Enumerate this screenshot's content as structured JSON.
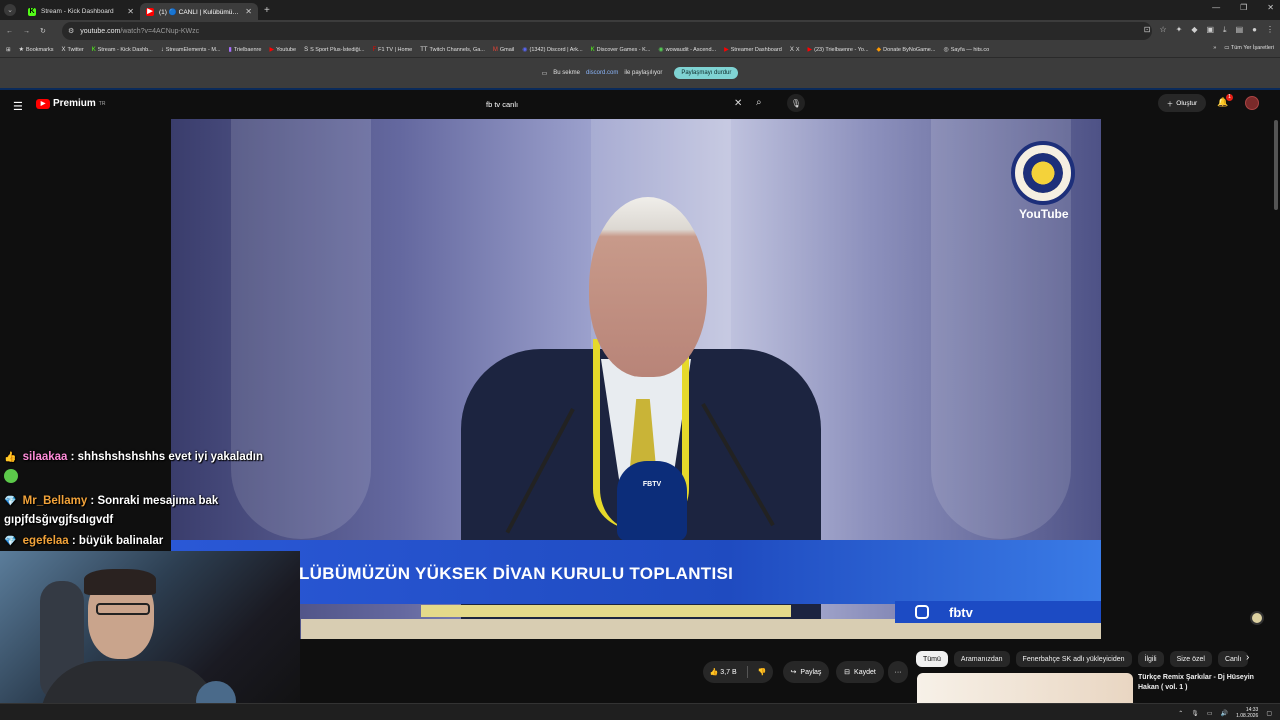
{
  "browser": {
    "tabs": [
      {
        "title": "Stream - Kick Dashboard",
        "icon": "kick-icon",
        "active": false
      },
      {
        "title": "(1) 🔵 CANLI | Kulübümüzün...",
        "icon": "youtube-icon",
        "active": true
      }
    ],
    "new_tab": "+",
    "url_host": "youtube.com",
    "url_path": "/watch?v=4ACNup-KWzc",
    "bookmarks": [
      "Bookmarks",
      "Twitter",
      "Stream - Kick Dashb...",
      "StreamElements - M...",
      "Trielbaenre",
      "Youtube",
      "S Sport Plus-İstediği...",
      "F1 TV | Home",
      "Twitch Channels, Ga...",
      "Gmail",
      "(1342) Discord | Ark...",
      "Discover Games - K...",
      "wowaudit - Ascend...",
      "Streamer Dashboard",
      "X",
      "(23) Trielbaenre - Yo...",
      "Donate ByNoGame...",
      "Sayfa — hits.co"
    ],
    "bookmarks_more": "»",
    "all_bookmarks": "Tüm Yer İşaretleri"
  },
  "share_bar": {
    "prefix": "Bu sekme",
    "domain": "discord.com",
    "suffix": "ile paylaşılıyor",
    "stop_button": "Paylaşmayı durdur"
  },
  "youtube": {
    "logo_text": "Premium",
    "logo_region": "TR",
    "search_value": "fb tv canlı",
    "create_button": "Oluştur",
    "notif_count": "1"
  },
  "video": {
    "lower_third": "LÜBÜMÜZÜN YÜKSEK DİVAN KURULU TOPLANTISI",
    "watermark": "YouTube",
    "handle": "fbtv",
    "mic_label": "FBTV",
    "channel_badge_text": "FBTV"
  },
  "actions": {
    "like_count": "3,7 B",
    "share": "Paylaş",
    "save": "Kaydet",
    "more": "···"
  },
  "chips": [
    "Tümü",
    "Aramanızdan",
    "Fenerbahçe SK adlı yükleyiciden",
    "İlgili",
    "Size özel",
    "Canlı"
  ],
  "recommendation": {
    "title": "Türkçe Remix Şarkılar - Dj Hüseyin Hakan ( vol. 1 )"
  },
  "chat": [
    {
      "user": "silaakaa",
      "text": ": shhshshshshhs evet iyi yakaladın",
      "icon": "👍"
    },
    {
      "user": "Mr_Bellamy",
      "text": ": Sonraki mesajıma bak gıpjfdsğıvgjfsdıgvdf",
      "icon": "💎"
    },
    {
      "user": "egefelaa",
      "text": ": büyük balinalar",
      "icon": "💎"
    }
  ],
  "taskbar": {
    "time": "14:33",
    "date": "1.08.2026"
  },
  "colors": {
    "yt_red": "#ff0000",
    "share_stop": "#7fd3d3",
    "lower_third_blue": "#1f4bc0"
  }
}
